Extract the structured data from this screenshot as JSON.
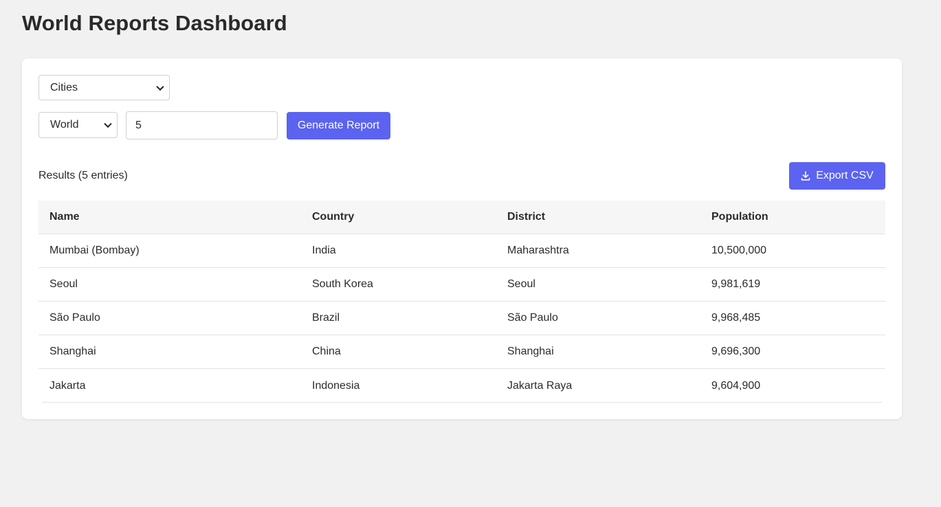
{
  "page": {
    "title": "World Reports Dashboard"
  },
  "controls": {
    "report_type": "Cities",
    "scope": "World",
    "limit": "5",
    "generate_label": "Generate Report"
  },
  "results": {
    "label": "Results (5 entries)",
    "export_label": "Export CSV",
    "export_icon": "download-icon",
    "columns": [
      "Name",
      "Country",
      "District",
      "Population"
    ],
    "rows": [
      [
        "Mumbai (Bombay)",
        "India",
        "Maharashtra",
        "10,500,000"
      ],
      [
        "Seoul",
        "South Korea",
        "Seoul",
        "9,981,619"
      ],
      [
        "São Paulo",
        "Brazil",
        "São Paulo",
        "9,968,485"
      ],
      [
        "Shanghai",
        "China",
        "Shanghai",
        "9,696,300"
      ],
      [
        "Jakarta",
        "Indonesia",
        "Jakarta Raya",
        "9,604,900"
      ]
    ]
  },
  "colors": {
    "accent": "#5b63f0",
    "background": "#f1f1f1",
    "card": "#ffffff",
    "header_row": "#f5f6f5"
  }
}
